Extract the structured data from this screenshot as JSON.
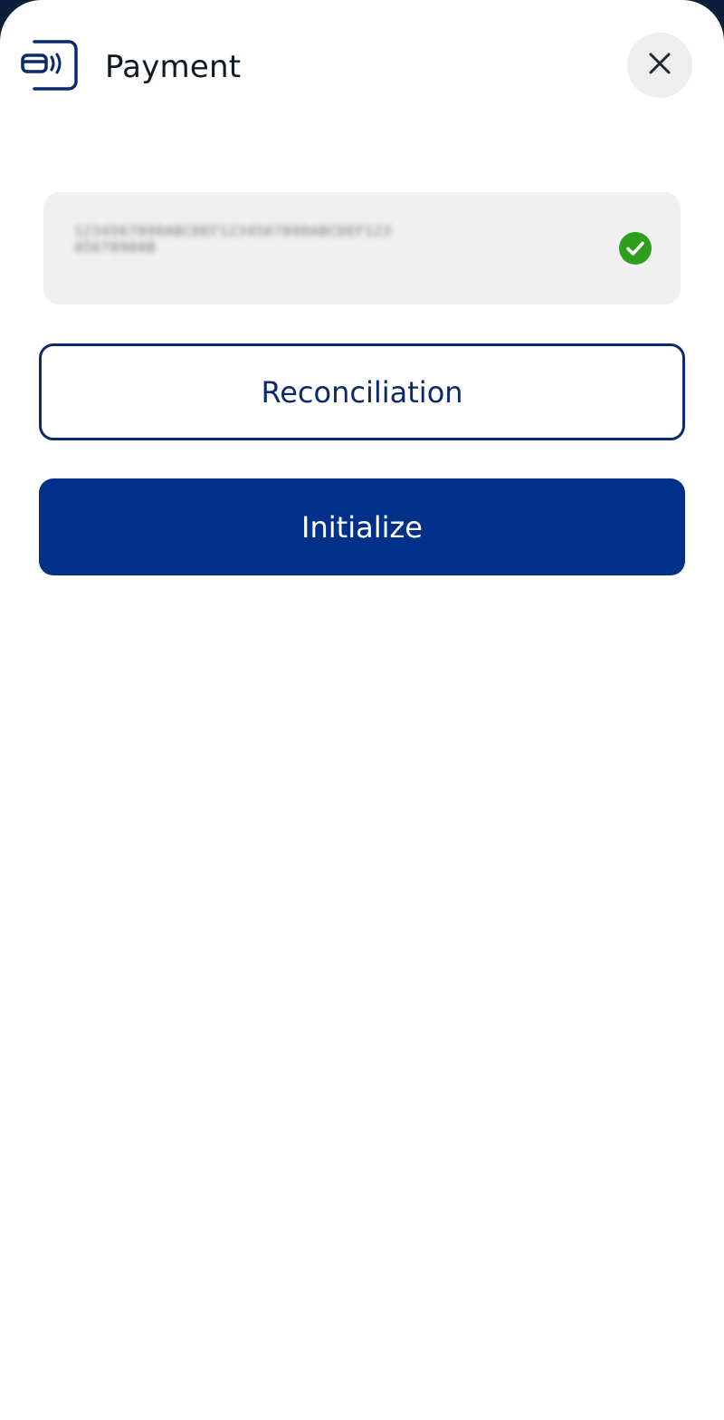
{
  "header": {
    "title": "Payment",
    "icon": "contactless-card-icon",
    "close_icon": "close-icon"
  },
  "terminal": {
    "value": "1234567890ABCDEF1234567890ABCDEF1234567890AB",
    "status_icon": "check-circle-icon",
    "status_color": "#2e9e1f"
  },
  "actions": {
    "reconciliation_label": "Reconciliation",
    "initialize_label": "Initialize"
  },
  "colors": {
    "brand": "#003087",
    "outline": "#0a2a6b",
    "field_bg": "#f0f0f0"
  }
}
